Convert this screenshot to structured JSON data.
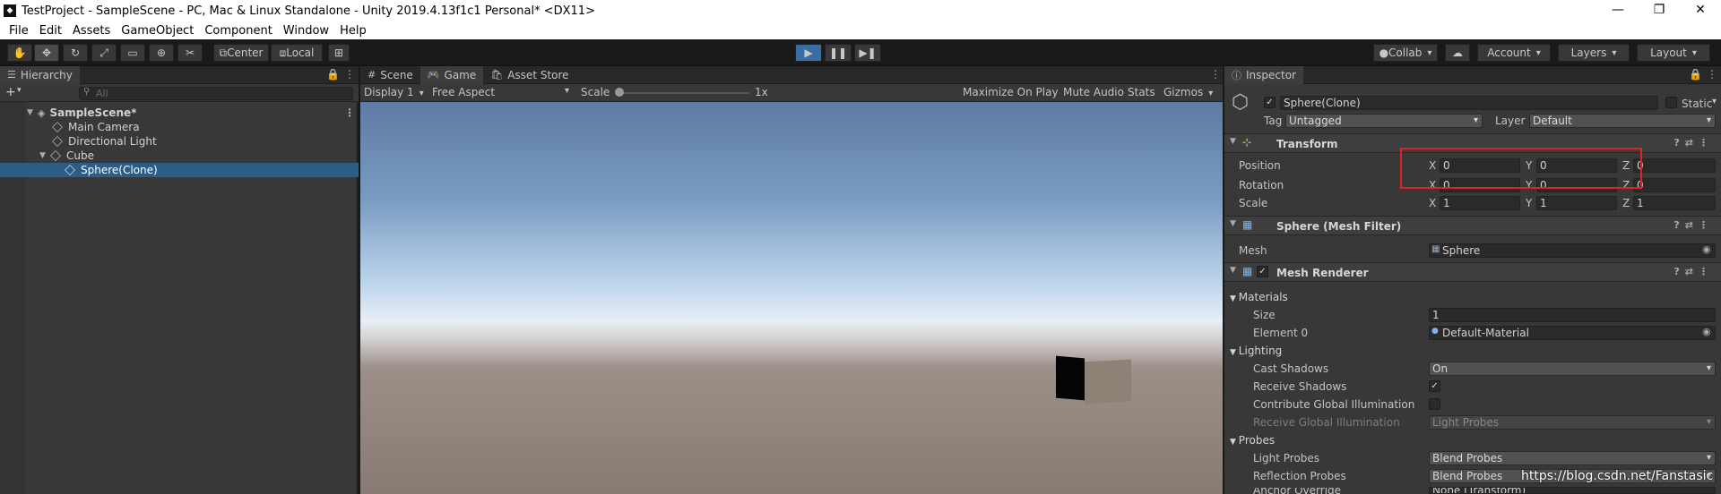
{
  "window": {
    "title": "TestProject - SampleScene - PC, Mac & Linux Standalone - Unity 2019.4.13f1c1 Personal* <DX11>",
    "minimize": "—",
    "maximize": "❐",
    "close": "✕"
  },
  "menu": [
    "File",
    "Edit",
    "Assets",
    "GameObject",
    "Component",
    "Window",
    "Help"
  ],
  "toolbar": {
    "pivot": "Center",
    "space": "Local",
    "collab": "Collab",
    "account": "Account",
    "layers": "Layers",
    "layout": "Layout"
  },
  "hierarchy": {
    "tab": "Hierarchy",
    "add": "+",
    "search_placeholder": "All",
    "items": [
      {
        "label": "SampleScene*"
      },
      {
        "label": "Main Camera"
      },
      {
        "label": "Directional Light"
      },
      {
        "label": "Cube"
      },
      {
        "label": "Sphere(Clone)"
      }
    ]
  },
  "game": {
    "tabs": [
      "Scene",
      "Game",
      "Asset Store"
    ],
    "display": "Display 1",
    "aspect": "Free Aspect",
    "scale_label": "Scale",
    "scale_value": "1x",
    "maximize": "Maximize On Play",
    "mute": "Mute Audio",
    "stats": "Stats",
    "gizmos": "Gizmos"
  },
  "inspector": {
    "tab": "Inspector",
    "object_name": "Sphere(Clone)",
    "static_label": "Static",
    "tag_label": "Tag",
    "tag_value": "Untagged",
    "layer_label": "Layer",
    "layer_value": "Default",
    "transform": {
      "title": "Transform",
      "position_label": "Position",
      "rotation_label": "Rotation",
      "scale_label": "Scale",
      "axis_x": "X",
      "axis_y": "Y",
      "axis_z": "Z",
      "position": [
        "0",
        "0",
        "0"
      ],
      "rotation": [
        "0",
        "0",
        "0"
      ],
      "scale": [
        "1",
        "1",
        "1"
      ]
    },
    "mesh_filter": {
      "title": "Sphere (Mesh Filter)",
      "mesh_label": "Mesh",
      "mesh_value": "Sphere"
    },
    "mesh_renderer": {
      "title": "Mesh Renderer",
      "materials": "Materials",
      "size_label": "Size",
      "size_value": "1",
      "element0_label": "Element 0",
      "element0_value": "Default-Material",
      "lighting": "Lighting",
      "cast_label": "Cast Shadows",
      "cast_value": "On",
      "receive_label": "Receive Shadows",
      "contribute_label": "Contribute Global Illumination",
      "receive_gi_label": "Receive Global Illumination",
      "receive_gi_value": "Light Probes",
      "probes": "Probes",
      "light_probes_label": "Light Probes",
      "light_probes_value": "Blend Probes",
      "reflection_label": "Reflection Probes",
      "reflection_value": "Blend Probes",
      "anchor_label": "Anchor Override",
      "anchor_value": "None (Transform)"
    }
  },
  "watermark": "https://blog.csdn.net/Fanstasic"
}
